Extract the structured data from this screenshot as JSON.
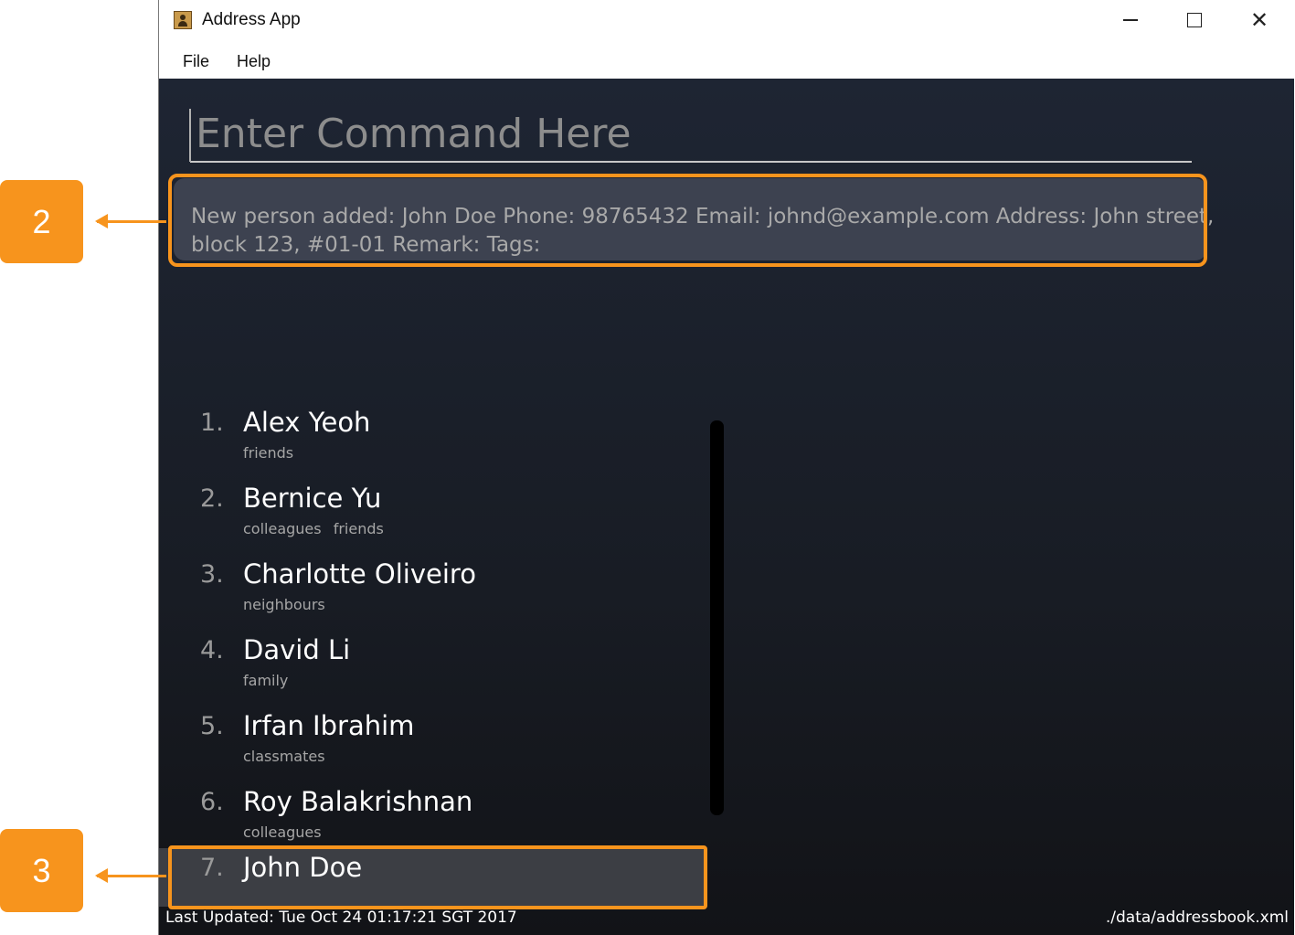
{
  "window": {
    "title": "Address App",
    "controls": {
      "minimize": "—",
      "maximize": "☐",
      "close": "✕"
    }
  },
  "menu": {
    "file": "File",
    "help": "Help"
  },
  "command": {
    "placeholder": "Enter Command Here",
    "value": ""
  },
  "result": {
    "line1": "New person added: John Doe Phone: 98765432 Email: johnd@example.com Address: John street,",
    "line2": "block 123, #01-01 Remark:  Tags:"
  },
  "persons": [
    {
      "index": "1.",
      "name": "Alex Yeoh",
      "tags": [
        "friends"
      ]
    },
    {
      "index": "2.",
      "name": "Bernice Yu",
      "tags": [
        "colleagues",
        "friends"
      ]
    },
    {
      "index": "3.",
      "name": "Charlotte Oliveiro",
      "tags": [
        "neighbours"
      ]
    },
    {
      "index": "4.",
      "name": "David Li",
      "tags": [
        "family"
      ]
    },
    {
      "index": "5.",
      "name": "Irfan Ibrahim",
      "tags": [
        "classmates"
      ]
    },
    {
      "index": "6.",
      "name": "Roy Balakrishnan",
      "tags": [
        "colleagues"
      ]
    },
    {
      "index": "7.",
      "name": "John Doe",
      "tags": []
    }
  ],
  "status": {
    "last_updated": "Last Updated: Tue Oct 24 01:17:21 SGT 2017",
    "file_path": "./data/addressbook.xml"
  },
  "annotations": {
    "callout_2": "2",
    "callout_3": "3"
  },
  "colors": {
    "accent": "#f7941d",
    "background": "#1e2533",
    "result_box": "#3d4250"
  }
}
